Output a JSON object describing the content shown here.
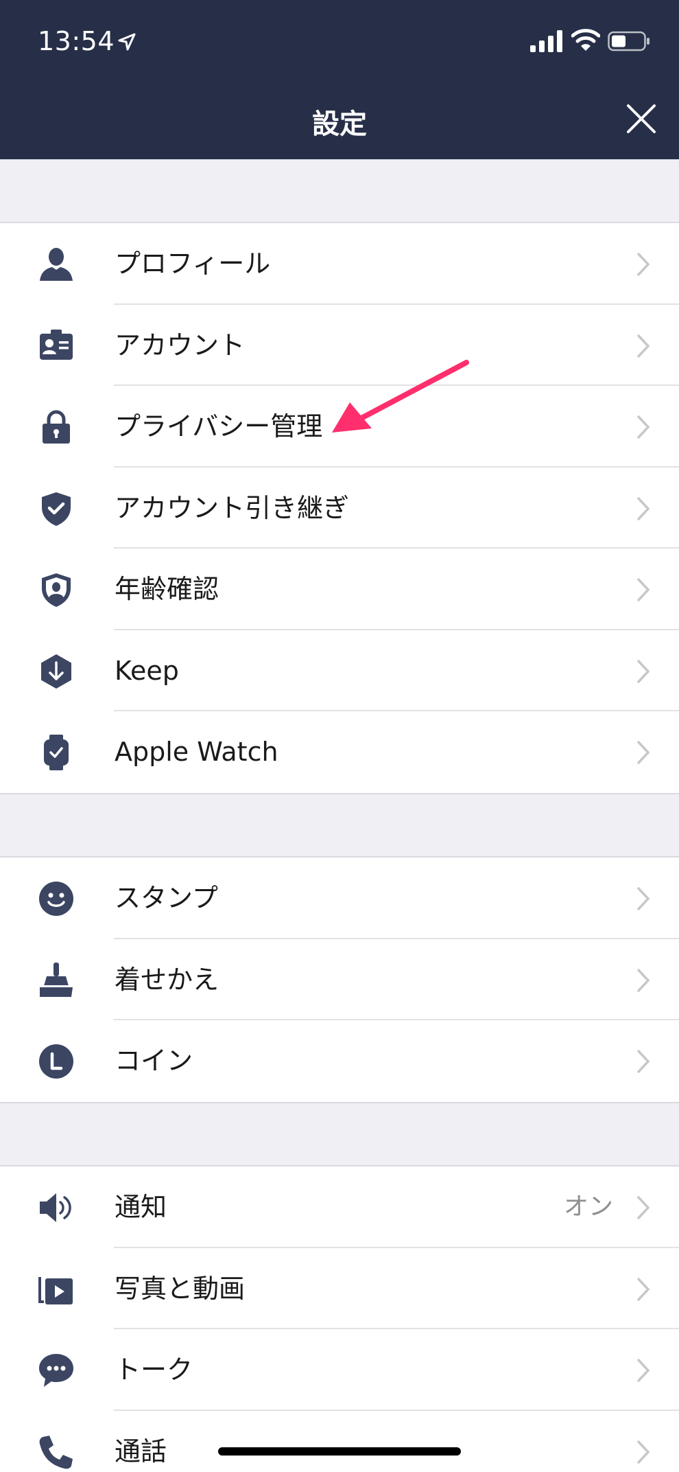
{
  "status_bar": {
    "time": "13:54"
  },
  "header": {
    "title": "設定"
  },
  "groups": [
    {
      "items": [
        {
          "label": "プロフィール",
          "icon": "person-icon"
        },
        {
          "label": "アカウント",
          "icon": "id-card-icon"
        },
        {
          "label": "プライバシー管理",
          "icon": "lock-icon"
        },
        {
          "label": "アカウント引き継ぎ",
          "icon": "shield-check-icon"
        },
        {
          "label": "年齢確認",
          "icon": "shield-person-icon"
        },
        {
          "label": "Keep",
          "icon": "keep-download-icon"
        },
        {
          "label": "Apple Watch",
          "icon": "watch-icon"
        }
      ]
    },
    {
      "items": [
        {
          "label": "スタンプ",
          "icon": "smiley-icon"
        },
        {
          "label": "着せかえ",
          "icon": "brush-icon"
        },
        {
          "label": "コイン",
          "icon": "coin-icon"
        }
      ]
    },
    {
      "items": [
        {
          "label": "通知",
          "value": "オン",
          "icon": "speaker-icon"
        },
        {
          "label": "写真と動画",
          "icon": "media-icon"
        },
        {
          "label": "トーク",
          "icon": "chat-bubble-icon"
        },
        {
          "label": "通話",
          "icon": "phone-icon"
        }
      ]
    }
  ],
  "colors": {
    "header_bg": "#272f48",
    "icon": "#3c4663",
    "annotation_arrow": "#ff2f6d",
    "background": "#efeff4"
  }
}
